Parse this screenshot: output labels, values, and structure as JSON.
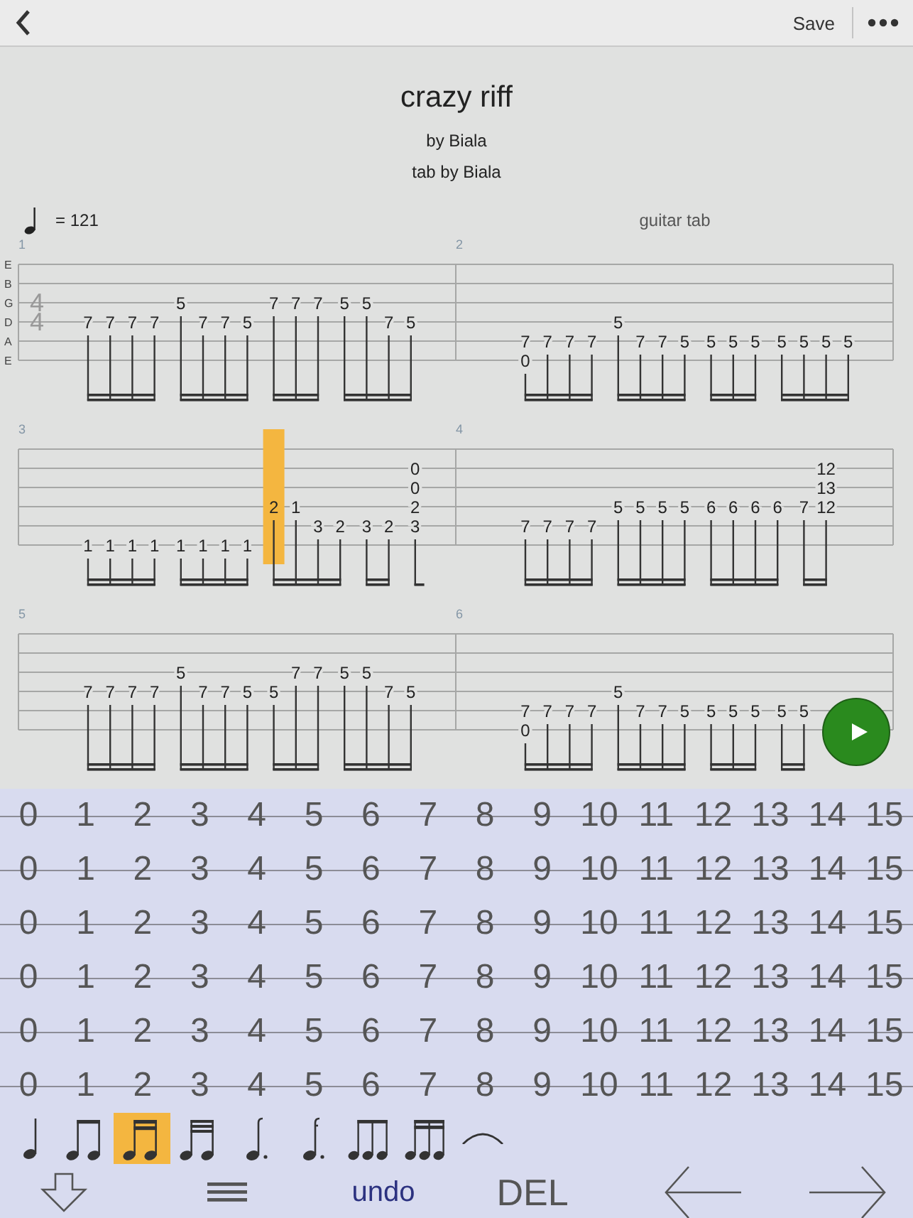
{
  "header": {
    "save_label": "Save"
  },
  "title": "crazy riff",
  "artist": "by Biala",
  "tabber": "tab by Biala",
  "tempo": "= 121",
  "track": "guitar tab",
  "string_labels": [
    "E",
    "B",
    "G",
    "D",
    "A",
    "E"
  ],
  "time_signature": [
    "4",
    "4"
  ],
  "systems": [
    {
      "measures": [
        {
          "number": "1",
          "groups": [
            {
              "beats": [
                {
                  "string_4": "7",
                  "selected": false
                },
                {
                  "string_4": "7",
                  "selected": false
                },
                {
                  "string_4": "7",
                  "selected": false
                },
                {
                  "string_4": "7",
                  "selected": false
                }
              ]
            },
            {
              "beats": [
                {
                  "string_3": "5",
                  "selected": false
                },
                {
                  "string_4": "7",
                  "selected": false
                },
                {
                  "string_4": "7",
                  "selected": false
                },
                {
                  "string_4": "5",
                  "selected": false
                }
              ]
            },
            {
              "beats": [
                {
                  "string_3": "7",
                  "selected": false
                },
                {
                  "string_3": "7",
                  "selected": false
                },
                {
                  "string_3": "7",
                  "selected": false
                }
              ]
            },
            {
              "beats": [
                {
                  "string_3": "5",
                  "selected": false
                },
                {
                  "string_3": "5",
                  "selected": false
                },
                {
                  "string_4": "7",
                  "selected": false
                },
                {
                  "string_4": "5",
                  "selected": false
                }
              ]
            }
          ]
        },
        {
          "number": "2",
          "groups": [
            {
              "beats": [
                {
                  "string_5": "7",
                  "string_6": "0",
                  "selected": false
                },
                {
                  "string_5": "7",
                  "selected": false
                },
                {
                  "string_5": "7",
                  "selected": false
                },
                {
                  "string_5": "7",
                  "selected": false
                }
              ]
            },
            {
              "beats": [
                {
                  "string_4": "5",
                  "selected": false
                },
                {
                  "string_5": "7",
                  "selected": false
                },
                {
                  "string_5": "7",
                  "selected": false
                },
                {
                  "string_5": "5",
                  "selected": false
                }
              ]
            },
            {
              "beats": [
                {
                  "string_5": "5",
                  "selected": false
                },
                {
                  "string_5": "5",
                  "selected": false
                },
                {
                  "string_5": "5",
                  "selected": false
                }
              ]
            },
            {
              "beats": [
                {
                  "string_5": "5",
                  "selected": false
                },
                {
                  "string_5": "5",
                  "selected": false
                },
                {
                  "string_5": "5",
                  "selected": false
                },
                {
                  "string_5": "5",
                  "selected": false
                }
              ]
            }
          ]
        }
      ]
    },
    {
      "measures": [
        {
          "number": "3",
          "groups": [
            {
              "beats": [
                {
                  "string_6": "1",
                  "selected": false
                },
                {
                  "string_6": "1",
                  "selected": false
                },
                {
                  "string_6": "1",
                  "selected": false
                },
                {
                  "string_6": "1",
                  "selected": false
                }
              ]
            },
            {
              "beats": [
                {
                  "string_6": "1",
                  "selected": false
                },
                {
                  "string_6": "1",
                  "selected": false
                },
                {
                  "string_6": "1",
                  "selected": false
                },
                {
                  "string_6": "1",
                  "selected": false
                }
              ]
            },
            {
              "beats": [
                {
                  "string_4": "2",
                  "selected": true
                },
                {
                  "string_4": "1",
                  "selected": false
                },
                {
                  "string_5": "3",
                  "selected": false
                },
                {
                  "string_5": "2",
                  "selected": false
                }
              ]
            },
            {
              "beats": [
                {
                  "string_5": "3",
                  "selected": false
                },
                {
                  "string_5": "2",
                  "selected": false
                }
              ]
            },
            {
              "beats": [
                {
                  "string_2": "0",
                  "string_3": "0",
                  "string_4": "2",
                  "string_5": "3",
                  "selected": false
                }
              ]
            }
          ]
        },
        {
          "number": "4",
          "groups": [
            {
              "beats": [
                {
                  "string_5": "7",
                  "selected": false
                },
                {
                  "string_5": "7",
                  "selected": false
                },
                {
                  "string_5": "7",
                  "selected": false
                },
                {
                  "string_5": "7",
                  "selected": false
                }
              ]
            },
            {
              "beats": [
                {
                  "string_4": "5",
                  "selected": false
                },
                {
                  "string_4": "5",
                  "selected": false
                },
                {
                  "string_4": "5",
                  "selected": false
                },
                {
                  "string_4": "5",
                  "selected": false
                }
              ]
            },
            {
              "beats": [
                {
                  "string_4": "6",
                  "selected": false
                },
                {
                  "string_4": "6",
                  "selected": false
                },
                {
                  "string_4": "6",
                  "selected": false
                },
                {
                  "string_4": "6",
                  "selected": false
                }
              ]
            },
            {
              "beats": [
                {
                  "string_4": "7",
                  "selected": false
                },
                {
                  "string_2": "12",
                  "string_3": "13",
                  "string_4": "12",
                  "selected": false
                }
              ]
            }
          ]
        }
      ]
    },
    {
      "measures": [
        {
          "number": "5",
          "groups": [
            {
              "beats": [
                {
                  "string_4": "7",
                  "selected": false
                },
                {
                  "string_4": "7",
                  "selected": false
                },
                {
                  "string_4": "7",
                  "selected": false
                },
                {
                  "string_4": "7",
                  "selected": false
                }
              ]
            },
            {
              "beats": [
                {
                  "string_3": "5",
                  "selected": false
                },
                {
                  "string_4": "7",
                  "selected": false
                },
                {
                  "string_4": "7",
                  "selected": false
                },
                {
                  "string_4": "5",
                  "selected": false
                }
              ]
            },
            {
              "beats": [
                {
                  "string_4": "5",
                  "selected": false
                },
                {
                  "string_3": "7",
                  "selected": false
                },
                {
                  "string_3": "7",
                  "selected": false
                }
              ]
            },
            {
              "beats": [
                {
                  "string_3": "5",
                  "selected": false
                },
                {
                  "string_3": "5",
                  "selected": false
                },
                {
                  "string_4": "7",
                  "selected": false
                },
                {
                  "string_4": "5",
                  "selected": false
                }
              ]
            }
          ]
        },
        {
          "number": "6",
          "groups": [
            {
              "beats": [
                {
                  "string_5": "7",
                  "string_6": "0",
                  "selected": false
                },
                {
                  "string_5": "7",
                  "selected": false
                },
                {
                  "string_5": "7",
                  "selected": false
                },
                {
                  "string_5": "7",
                  "selected": false
                }
              ]
            },
            {
              "beats": [
                {
                  "string_4": "5",
                  "selected": false
                },
                {
                  "string_5": "7",
                  "selected": false
                },
                {
                  "string_5": "7",
                  "selected": false
                },
                {
                  "string_5": "5",
                  "selected": false
                }
              ]
            },
            {
              "beats": [
                {
                  "string_5": "5",
                  "selected": false
                },
                {
                  "string_5": "5",
                  "selected": false
                },
                {
                  "string_5": "5",
                  "selected": false
                }
              ]
            },
            {
              "beats": [
                {
                  "string_5": "5",
                  "selected": false
                },
                {
                  "string_5": "5",
                  "selected": false
                }
              ]
            }
          ]
        }
      ]
    }
  ],
  "fret_grid": [
    {
      "frets": [
        "0",
        "1",
        "2",
        "3",
        "4",
        "5",
        "6",
        "7",
        "8",
        "9",
        "10",
        "11",
        "12",
        "13",
        "14",
        "15"
      ]
    },
    {
      "frets": [
        "0",
        "1",
        "2",
        "3",
        "4",
        "5",
        "6",
        "7",
        "8",
        "9",
        "10",
        "11",
        "12",
        "13",
        "14",
        "15"
      ]
    },
    {
      "frets": [
        "0",
        "1",
        "2",
        "3",
        "4",
        "5",
        "6",
        "7",
        "8",
        "9",
        "10",
        "11",
        "12",
        "13",
        "14",
        "15"
      ]
    },
    {
      "frets": [
        "0",
        "1",
        "2",
        "3",
        "4",
        "5",
        "6",
        "7",
        "8",
        "9",
        "10",
        "11",
        "12",
        "13",
        "14",
        "15"
      ]
    },
    {
      "frets": [
        "0",
        "1",
        "2",
        "3",
        "4",
        "5",
        "6",
        "7",
        "8",
        "9",
        "10",
        "11",
        "12",
        "13",
        "14",
        "15"
      ]
    },
    {
      "frets": [
        "0",
        "1",
        "2",
        "3",
        "4",
        "5",
        "6",
        "7",
        "8",
        "9",
        "10",
        "11",
        "12",
        "13",
        "14",
        "15"
      ]
    }
  ],
  "note_values": [
    {
      "kind": "quarter",
      "selected": false
    },
    {
      "kind": "eighth",
      "selected": false
    },
    {
      "kind": "sixteenth",
      "selected": true
    },
    {
      "kind": "thirty_second",
      "selected": false
    },
    {
      "kind": "dotted_eighth",
      "selected": false
    },
    {
      "kind": "dotted_sixteenth",
      "selected": false
    },
    {
      "kind": "triplet_eighth",
      "selected": false
    },
    {
      "kind": "triplet_sixteenth",
      "selected": false
    },
    {
      "kind": "tie",
      "selected": false
    }
  ],
  "actions": [
    {
      "kind": "collapse"
    },
    {
      "kind": "menu"
    },
    {
      "kind": "undo",
      "label": "undo"
    },
    {
      "kind": "delete",
      "label": "DEL"
    },
    {
      "kind": "back"
    },
    {
      "kind": "forward"
    }
  ]
}
